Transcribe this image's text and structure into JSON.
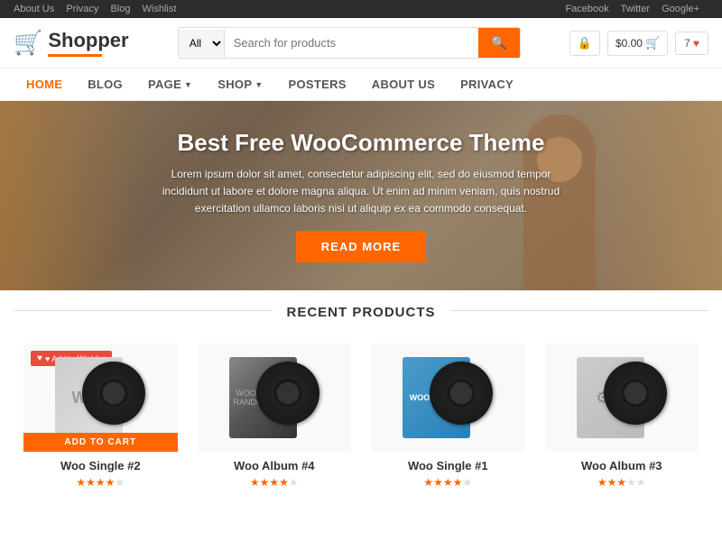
{
  "topbar": {
    "left_links": [
      "About Us",
      "Privacy",
      "Blog",
      "Wishlist"
    ],
    "right_links": [
      "Facebook",
      "Twitter",
      "Google+"
    ]
  },
  "header": {
    "logo_text": "Shopper",
    "search_placeholder": "Search for products",
    "search_select_label": "All",
    "search_btn_icon": "🔍",
    "cart_price": "$0.00",
    "wishlist_count": "7"
  },
  "nav": {
    "items": [
      {
        "label": "HOME",
        "active": true,
        "has_dropdown": false
      },
      {
        "label": "BLOG",
        "active": false,
        "has_dropdown": false
      },
      {
        "label": "PAGE",
        "active": false,
        "has_dropdown": true
      },
      {
        "label": "SHOP",
        "active": false,
        "has_dropdown": true
      },
      {
        "label": "POSTERS",
        "active": false,
        "has_dropdown": false
      },
      {
        "label": "ABOUT US",
        "active": false,
        "has_dropdown": false
      },
      {
        "label": "PRIVACY",
        "active": false,
        "has_dropdown": false
      }
    ]
  },
  "hero": {
    "title": "Best Free WooCommerce Theme",
    "body": "Lorem ipsum dolor sit amet, consectetur adipiscing elit, sed do eiusmod tempor incididunt ut labore et dolore magna aliqua. Ut enim ad minim veniam, quis nostrud exercitation ullamco laboris nisi ut aliquip ex ea commodo consequat.",
    "cta_label": "READ MORE"
  },
  "products_section": {
    "title": "RECENT PRODUCTS",
    "products": [
      {
        "name": "Woo Single #2",
        "stars": 4,
        "sleeve_class": "sleeve-woo2",
        "show_wishlist": true,
        "show_cart": true
      },
      {
        "name": "Woo Album #4",
        "stars": 4,
        "sleeve_class": "sleeve-woo4",
        "show_wishlist": false,
        "show_cart": false
      },
      {
        "name": "Woo Single #1",
        "stars": 4,
        "sleeve_class": "sleeve-woo1",
        "show_wishlist": false,
        "show_cart": false
      },
      {
        "name": "Woo Album #3",
        "stars": 3,
        "sleeve_class": "sleeve-woo3",
        "show_wishlist": false,
        "show_cart": false
      }
    ],
    "wishlist_label": "♥ Add to Wishlist",
    "cart_label": "ADD TO CART"
  },
  "colors": {
    "accent": "#ff6600",
    "topbar_bg": "#2c2c2c",
    "danger": "#e74c3c"
  }
}
